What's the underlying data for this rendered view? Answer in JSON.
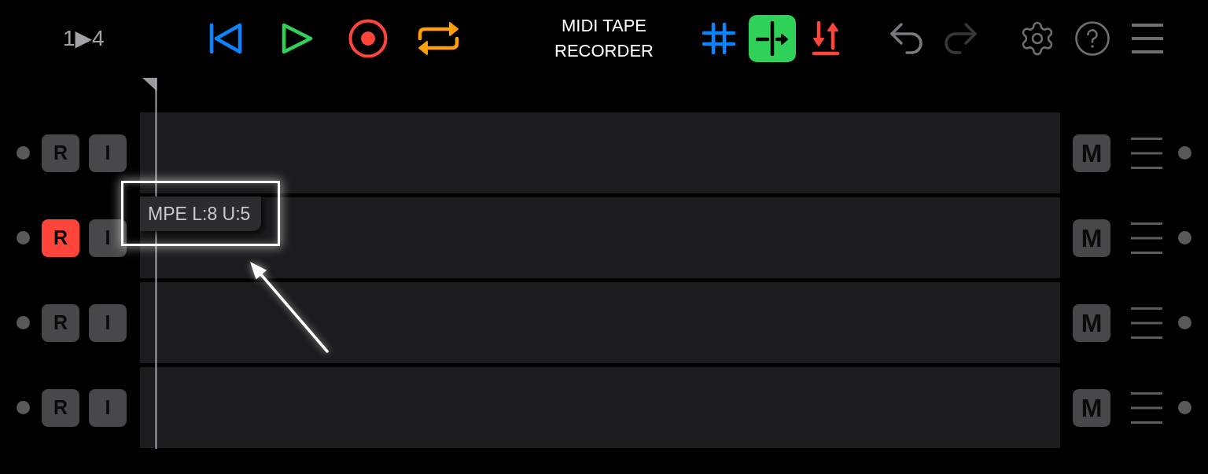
{
  "toolbar": {
    "counter": "1▶4",
    "transport_buttons": [
      {
        "kind": "rewind"
      },
      {
        "kind": "play"
      },
      {
        "kind": "record"
      },
      {
        "kind": "loop"
      }
    ],
    "title": "MIDI TAPE RECORDER",
    "edit_buttons": [
      {
        "kind": "grid",
        "selected": false
      },
      {
        "kind": "split",
        "selected": true
      },
      {
        "kind": "transpose",
        "selected": false
      }
    ],
    "history_buttons": [
      {
        "kind": "undo",
        "disabled": false
      },
      {
        "kind": "redo",
        "disabled": true
      }
    ],
    "utility_buttons": [
      {
        "kind": "settings"
      },
      {
        "kind": "help"
      },
      {
        "kind": "menu"
      }
    ]
  },
  "tracks": [
    {
      "record_label": "R",
      "armed": false,
      "input_label": "I",
      "input_on": false,
      "mute_label": "M",
      "muted": false
    },
    {
      "record_label": "R",
      "armed": true,
      "input_label": "I",
      "input_on": false,
      "mute_label": "M",
      "muted": false,
      "mpe_badge": "MPE L:8 U:5"
    },
    {
      "record_label": "R",
      "armed": false,
      "input_label": "I",
      "input_on": false,
      "mute_label": "M",
      "muted": false
    },
    {
      "record_label": "R",
      "armed": false,
      "input_label": "I",
      "input_on": false,
      "mute_label": "M",
      "muted": false
    }
  ]
}
